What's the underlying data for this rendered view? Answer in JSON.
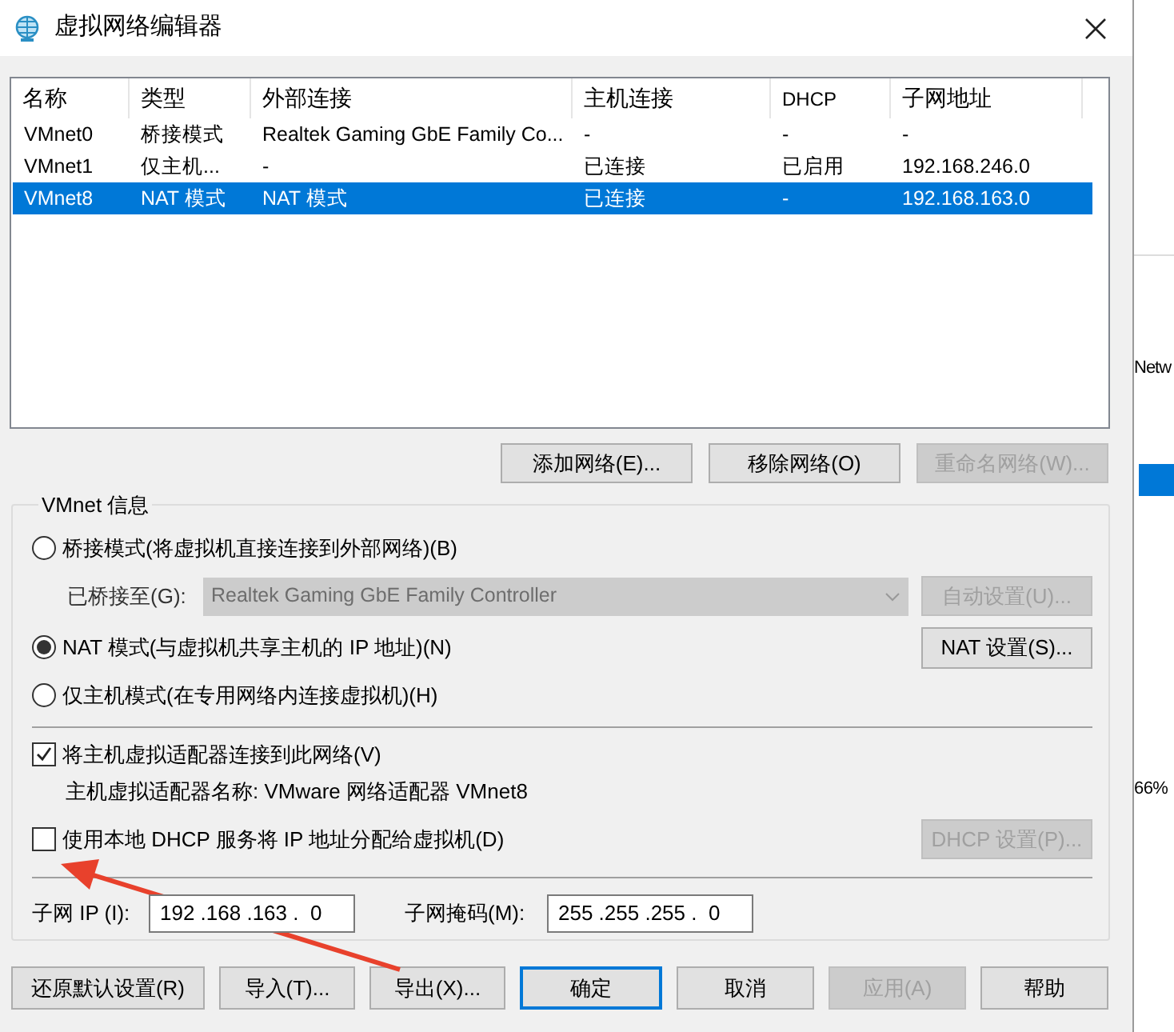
{
  "window": {
    "title": "虚拟网络编辑器"
  },
  "network_table": {
    "columns": [
      "名称",
      "类型",
      "外部连接",
      "主机连接",
      "DHCP",
      "子网地址"
    ],
    "rows": [
      {
        "cells": [
          "VMnet0",
          "桥接模式",
          "Realtek Gaming GbE Family Co...",
          "-",
          "-",
          "-"
        ],
        "selected": false
      },
      {
        "cells": [
          "VMnet1",
          "仅主机...",
          "-",
          "已连接",
          "已启用",
          "192.168.246.0"
        ],
        "selected": false
      },
      {
        "cells": [
          "VMnet8",
          "NAT 模式",
          "NAT 模式",
          "已连接",
          "-",
          "192.168.163.0"
        ],
        "selected": true
      }
    ]
  },
  "table_buttons": [
    {
      "label": "添加网络(E)...",
      "disabled": false
    },
    {
      "label": "移除网络(O)",
      "disabled": false
    },
    {
      "label": "重命名网络(W)...",
      "disabled": true
    }
  ],
  "vmnet_info": {
    "title": "VMnet 信息",
    "modes": [
      {
        "label": "桥接模式(将虚拟机直接连接到外部网络)(B)",
        "selected": false
      },
      {
        "label": "NAT 模式(与虚拟机共享主机的 IP 地址)(N)",
        "selected": true
      },
      {
        "label": "仅主机模式(在专用网络内连接虚拟机)(H)",
        "selected": false
      }
    ],
    "bridged_to": {
      "label": "已桥接至(G):",
      "value": "Realtek Gaming GbE Family Controller",
      "disabled": true
    },
    "auto_button": {
      "label": "自动设置(U)...",
      "disabled": true
    },
    "nat_button": {
      "label": "NAT 设置(S)...",
      "disabled": false
    },
    "connect_adapter": {
      "label": "将主机虚拟适配器连接到此网络(V)",
      "checked": true
    },
    "adapter_name": "主机虚拟适配器名称: VMware 网络适配器 VMnet8",
    "dhcp": {
      "label": "使用本地 DHCP 服务将 IP 地址分配给虚拟机(D)",
      "checked": false
    },
    "dhcp_button": {
      "label": "DHCP 设置(P)...",
      "disabled": true
    },
    "subnet_ip": {
      "label": "子网 IP (I):",
      "value": "192 .168 .163 .  0"
    },
    "subnet_mask": {
      "label": "子网掩码(M):",
      "value": "255 .255 .255 .  0"
    }
  },
  "bottom_buttons": [
    {
      "label": "还原默认设置(R)",
      "disabled": false,
      "default": false
    },
    {
      "label": "导入(T)...",
      "disabled": false,
      "default": false
    },
    {
      "label": "导出(X)...",
      "disabled": false,
      "default": false
    },
    {
      "label": "确定",
      "disabled": false,
      "default": true
    },
    {
      "label": "取消",
      "disabled": false,
      "default": false
    },
    {
      "label": "应用(A)",
      "disabled": true,
      "default": false
    },
    {
      "label": "帮助",
      "disabled": false,
      "default": false
    }
  ],
  "background_window": {
    "texts": [
      "Netw",
      "66%"
    ]
  }
}
